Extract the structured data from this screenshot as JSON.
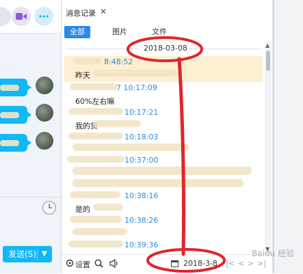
{
  "history_panel": {
    "tab_title": "消息记录",
    "close_glyph": "✕",
    "filters": [
      {
        "label": "全部",
        "active": true
      },
      {
        "label": "图片",
        "active": false
      },
      {
        "label": "文件",
        "active": false
      }
    ],
    "date_header": "2018-03-08",
    "messages": [
      {
        "time": "8:48:52",
        "body": "昨天"
      },
      {
        "time": "7 10:17:09",
        "body": "60%左右嘛"
      },
      {
        "time": "10:17:21",
        "body": "我的货"
      },
      {
        "time": "10:18:03",
        "body": ""
      },
      {
        "time": "10:37:00",
        "body": ""
      },
      {
        "time": "10:38:16",
        "body": "是的"
      },
      {
        "time": "10:38:26",
        "body": ""
      },
      {
        "time": "10:39:36",
        "body": ""
      }
    ],
    "bottom_bar": {
      "settings_label": "设置",
      "search_icon": "magnifier-icon",
      "voice_icon": "speaker-icon",
      "date_value": "2018-3-8",
      "nav": [
        "|<",
        "<",
        ">",
        ">|"
      ]
    }
  },
  "chat_panel": {
    "send_label": "发送(S)",
    "send_arrow": "▼"
  },
  "watermark": "Baidu 经验",
  "colors": {
    "accent": "#12b7f5",
    "tab_active": "#2b8ae8",
    "time_text": "#2e8bd6",
    "highlight": "#fcefd2",
    "annotation": "#e0252b"
  }
}
